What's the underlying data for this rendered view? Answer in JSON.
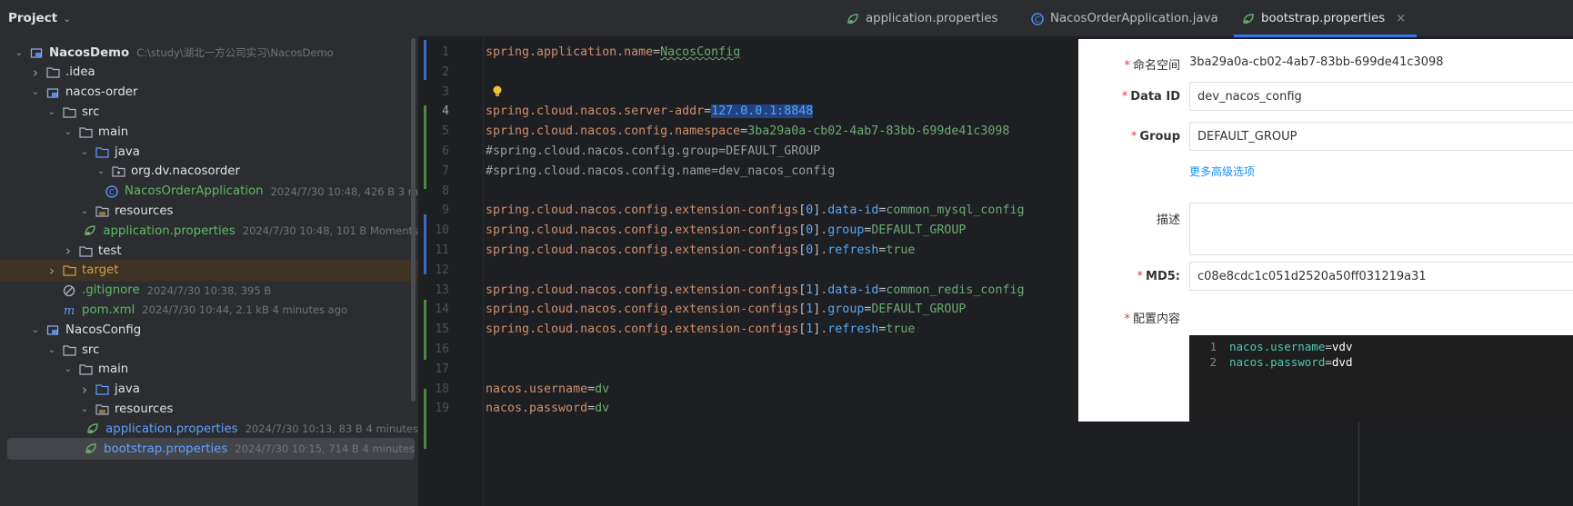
{
  "project_panel": {
    "title": "Project",
    "tree": [
      {
        "label": "NacosDemo",
        "meta": "C:\\study\\湖北一方公司实习\\NacosDemo",
        "icon": "module-icon",
        "expanded": true,
        "bold": true
      },
      {
        "label": ".idea",
        "icon": "folder-icon",
        "expanded": false
      },
      {
        "label": "nacos-order",
        "icon": "module-icon",
        "expanded": true
      },
      {
        "label": "src",
        "icon": "folder-icon",
        "expanded": true
      },
      {
        "label": "main",
        "icon": "folder-icon",
        "expanded": true
      },
      {
        "label": "java",
        "icon": "source-folder-icon",
        "expanded": true
      },
      {
        "label": "org.dv.nacosorder",
        "icon": "package-icon",
        "expanded": true
      },
      {
        "label": "NacosOrderApplication",
        "meta": "2024/7/30 10:48, 426 B 3 m",
        "icon": "spring-class-icon",
        "style": "green"
      },
      {
        "label": "resources",
        "icon": "resources-folder-icon",
        "expanded": true
      },
      {
        "label": "application.properties",
        "meta": "2024/7/30 10:48, 101 B Moments",
        "icon": "spring-properties-icon",
        "style": "green"
      },
      {
        "label": "test",
        "icon": "folder-icon",
        "expanded": false
      },
      {
        "label": "target",
        "icon": "excluded-folder-icon",
        "expanded": false,
        "style": "amber"
      },
      {
        "label": ".gitignore",
        "meta": "2024/7/30 10:38, 395 B",
        "icon": "ignore-file-icon",
        "style": "green"
      },
      {
        "label": "pom.xml",
        "meta": "2024/7/30 10:44, 2.1 kB 4 minutes ago",
        "icon": "maven-icon",
        "style": "green"
      },
      {
        "label": "NacosConfig",
        "icon": "module-icon",
        "expanded": true
      },
      {
        "label": "src",
        "icon": "folder-icon",
        "expanded": true
      },
      {
        "label": "main",
        "icon": "folder-icon",
        "expanded": true
      },
      {
        "label": "java",
        "icon": "source-folder-icon",
        "expanded": false
      },
      {
        "label": "resources",
        "icon": "resources-folder-icon",
        "expanded": true
      },
      {
        "label": "application.properties",
        "meta": "2024/7/30 10:13, 83 B 4 minutes",
        "icon": "spring-properties-icon",
        "style": "blue"
      },
      {
        "label": "bootstrap.properties",
        "meta": "2024/7/30 10:15, 714 B 4 minutes",
        "icon": "spring-properties-icon",
        "style": "blue",
        "selected": true
      }
    ]
  },
  "tabs": [
    {
      "label": "application.properties",
      "icon": "spring-properties-icon",
      "active": false
    },
    {
      "label": "NacosOrderApplication.java",
      "icon": "spring-class-icon",
      "active": false
    },
    {
      "label": "bootstrap.properties",
      "icon": "spring-properties-icon",
      "active": true,
      "close": "×"
    }
  ],
  "editor": {
    "current_line": 4,
    "lines": [
      {
        "n": "1",
        "key": "spring.application.name",
        "val": "NacosConfig"
      },
      {
        "n": "2"
      },
      {
        "n": "3"
      },
      {
        "n": "4",
        "key": "spring.cloud.nacos.server-addr",
        "val": "127.0.0.1:8848"
      },
      {
        "n": "5",
        "key": "spring.cloud.nacos.config.namespace",
        "val": "3ba29a0a-cb02-4ab7-83bb-699de41c3098"
      },
      {
        "n": "6",
        "comment": "#spring.cloud.nacos.config.group=DEFAULT_GROUP"
      },
      {
        "n": "7",
        "comment": "#spring.cloud.nacos.config.name=dev_nacos_config"
      },
      {
        "n": "8"
      },
      {
        "n": "9",
        "key": "spring.cloud.nacos.config.extension-configs",
        "idx": "0",
        "prop": "data-id",
        "val": "common_mysql_config"
      },
      {
        "n": "10",
        "key": "spring.cloud.nacos.config.extension-configs",
        "idx": "0",
        "prop": "group",
        "val": "DEFAULT_GROUP"
      },
      {
        "n": "11",
        "key": "spring.cloud.nacos.config.extension-configs",
        "idx": "0",
        "prop": "refresh",
        "val": "true"
      },
      {
        "n": "12"
      },
      {
        "n": "13",
        "key": "spring.cloud.nacos.config.extension-configs",
        "idx": "1",
        "prop": "data-id",
        "val": "common_redis_config"
      },
      {
        "n": "14",
        "key": "spring.cloud.nacos.config.extension-configs",
        "idx": "1",
        "prop": "group",
        "val": "DEFAULT_GROUP"
      },
      {
        "n": "15",
        "key": "spring.cloud.nacos.config.extension-configs",
        "idx": "1",
        "prop": "refresh",
        "val": "true"
      },
      {
        "n": "16"
      },
      {
        "n": "17"
      },
      {
        "n": "18",
        "key": "nacos.username",
        "val": "dv"
      },
      {
        "n": "19",
        "key": "nacos.password",
        "val": "dv"
      }
    ]
  },
  "dialog": {
    "namespace_label": "命名空间",
    "namespace_value": "3ba29a0a-cb02-4ab7-83bb-699de41c3098",
    "data_id_label": "Data ID",
    "data_id_value": "dev_nacos_config",
    "group_label": "Group",
    "group_value": "DEFAULT_GROUP",
    "advanced_link": "更多高级选项",
    "description_label": "描述",
    "md5_label": "MD5:",
    "md5_value": "c08e8cdc1c051d2520a50ff031219a31",
    "content_label": "配置内容",
    "content_lines": [
      {
        "n": "1",
        "key": "nacos.username",
        "val": "vdv"
      },
      {
        "n": "2",
        "key": "nacos.password",
        "val": "dvd"
      }
    ],
    "required_mark": "*"
  },
  "colors": {
    "accent": "#3574f0",
    "property_key": "#cf8e6d",
    "property_value": "#6aab73",
    "vcs_modified": "#3a6bc5",
    "vcs_added": "#4f8a3f",
    "required": "#e4393c",
    "link": "#1890ff"
  }
}
